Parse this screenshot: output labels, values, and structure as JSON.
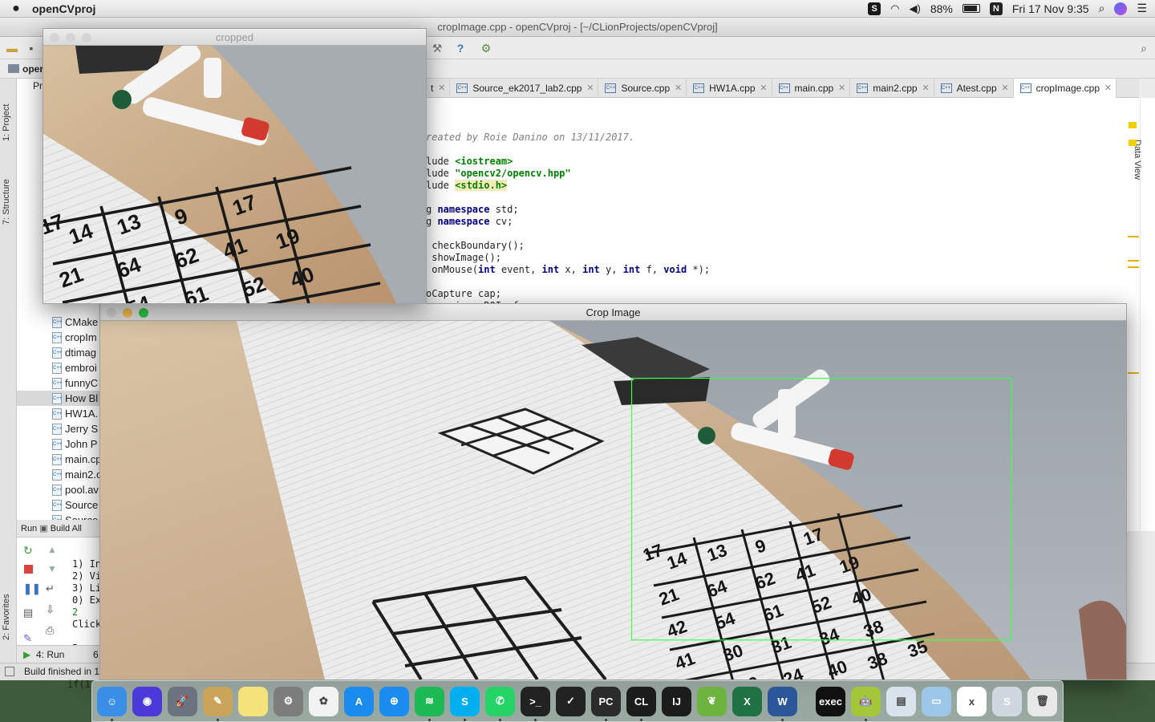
{
  "menubar": {
    "app_name": "openCVproj",
    "battery": "88%",
    "datetime": "Fri 17 Nov  9:35"
  },
  "ide": {
    "title": "cropImage.cpp - openCVproj - [~/CLionProjects/openCVproj]",
    "nav_root": "oper",
    "project_header": "Pr",
    "left_tabs": [
      "1: Project",
      "7: Structure",
      "2: Favorites"
    ],
    "right_tabs": [
      "Data View"
    ],
    "tabs": [
      {
        "label": "t"
      },
      {
        "label": "Source_ek2017_lab2.cpp"
      },
      {
        "label": "Source.cpp"
      },
      {
        "label": "HW1A.cpp"
      },
      {
        "label": "main.cpp"
      },
      {
        "label": "main2.cpp"
      },
      {
        "label": "Atest.cpp"
      },
      {
        "label": "cropImage.cpp",
        "active": true
      }
    ],
    "project_files": [
      "CMake",
      "cropIm",
      "dtimag",
      "embroi",
      "funnyC",
      "How Bl",
      "HW1A.",
      "Jerry S",
      "John P",
      "main.cp",
      "main2.c",
      "pool.av",
      "Source",
      "Source"
    ],
    "code_lines": [
      {
        "cls": "cmt",
        "text": "reated by Roie Danino on 13/11/2017."
      },
      {
        "cls": "",
        "text": ""
      },
      {
        "cls": "",
        "text": "lude <iostream>"
      },
      {
        "cls": "",
        "text": "lude \"opencv2/opencv.hpp\""
      },
      {
        "cls": "",
        "text": "lude <stdio.h>"
      },
      {
        "cls": "",
        "text": ""
      },
      {
        "cls": "",
        "text": "g namespace std;"
      },
      {
        "cls": "",
        "text": "g namespace cv;"
      },
      {
        "cls": "",
        "text": ""
      },
      {
        "cls": "",
        "text": " checkBoundary();"
      },
      {
        "cls": "",
        "text": " showImage();"
      },
      {
        "cls": "",
        "text": " onMouse(int event, int x, int y, int f, void *);"
      },
      {
        "cls": "",
        "text": ""
      },
      {
        "cls": "",
        "text": "oCapture cap;"
      },
      {
        "cls": "",
        "text": "src, img, ROI, frame;"
      }
    ],
    "run": {
      "tab_run": "Run",
      "tab_build": "Build All",
      "lines": [
        "1) In",
        "2) Vi",
        "3) Li",
        "0) Ex",
        "2",
        "Click",
        "",
        "Press"
      ],
      "bottom_tab_run": "4: Run",
      "bottom_tab_6": "6"
    },
    "status_text": "Build finished in 1",
    "bottom_code": "if(1"
  },
  "windows": {
    "cropped": {
      "title": "cropped"
    },
    "crop_image": {
      "title": "Crop Image",
      "selection": {
        "from_x": 0.518,
        "from_y": 0.16,
        "to_x": 0.888,
        "to_y": 0.89
      }
    }
  },
  "board_numbers": [
    "14",
    "13",
    "9",
    "17",
    "21",
    "64",
    "62",
    "41",
    "19",
    "42",
    "54",
    "61",
    "52",
    "40",
    "41",
    "30",
    "31",
    "34",
    "38",
    "20",
    "24",
    "40",
    "38",
    "35",
    "17"
  ],
  "colors": {
    "selection": "#3cff4c",
    "accent": "#3478f6"
  },
  "dock": [
    "Finder",
    "Siri",
    "Launchpad",
    "Preview",
    "Notes",
    "System Preferences",
    "Photos",
    "App Store",
    "Safari",
    "Spotify",
    "Skype",
    "WhatsApp",
    "Terminal",
    "Inkscape",
    "PyCharm",
    "CLion",
    "IntelliJ IDEA",
    "Spring",
    "Excel",
    "Word",
    "Exec",
    "Android",
    "Documents",
    "Folder",
    "Excel File",
    "Skype File",
    "Trash"
  ]
}
